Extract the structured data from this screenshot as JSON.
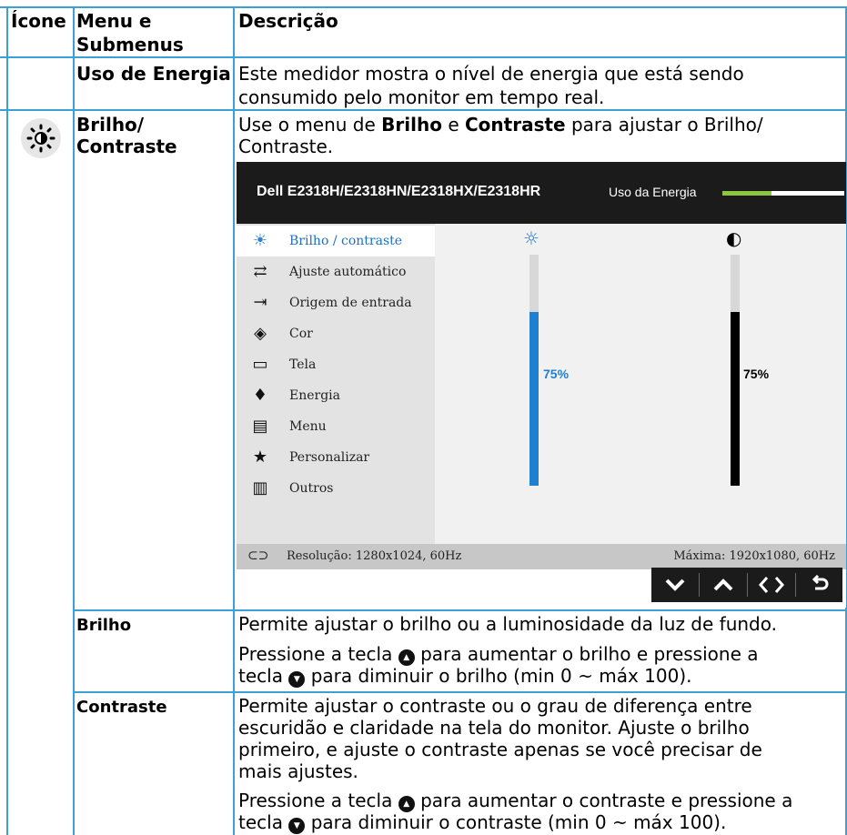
{
  "table": {
    "headers": {
      "icon": "Ícone",
      "menu": "Menu e Submenus",
      "menu_line1": "Menu e",
      "menu_line2": "Submenus",
      "desc": "Descrição"
    },
    "energy_row": {
      "name": "Uso de Energia",
      "desc_line1": "Este medidor mostra o nível de energia que está sendo",
      "desc_line2": "consumido pelo monitor em tempo real."
    },
    "brightness_row": {
      "name_line1": "Brilho/",
      "name_line2": "Contraste",
      "desc_use": "Use o menu de",
      "desc_bold1": "Brilho",
      "desc_e": "e",
      "desc_bold2": "Contraste",
      "desc_rest": "para ajustar o Brilho/",
      "desc_line2": "Contraste."
    },
    "brilho_row": {
      "name": "Brilho",
      "desc_line1": "Permite ajustar o brilho ou a luminosidade da luz de fundo.",
      "press_a": "Pressione a tecla",
      "press_b": "para aumentar o brilho e pressione a",
      "press_c": "tecla",
      "press_d": "para diminuir o brilho (min 0 ~ máx 100)."
    },
    "contraste_row": {
      "name": "Contraste",
      "desc_line1": "Permite ajustar o contraste ou o grau de diferença entre",
      "desc_line2": "escuridão e claridade na tela do monitor. Ajuste o brilho",
      "desc_line3": "primeiro, e ajuste o contraste apenas se você precisar de",
      "desc_line4": "mais ajustes.",
      "press_a": "Pressione a tecla",
      "press_b": "para aumentar o contraste e pressione a",
      "press_c": "tecla",
      "press_d": "para diminuir o contraste (min 0 ~ máx 100)."
    }
  },
  "osd": {
    "model": "Dell E2318H/E2318HN/E2318HX/E2318HR",
    "power_label": "Uso da Energia",
    "power_level": 0.4,
    "menu_items": [
      {
        "label": "Brilho / contraste",
        "icon": "sun-contrast-icon",
        "glyph": "☀"
      },
      {
        "label": "Ajuste automático",
        "icon": "auto-adjust-icon",
        "glyph": "⇄"
      },
      {
        "label": "Origem de entrada",
        "icon": "input-source-icon",
        "glyph": "⇥"
      },
      {
        "label": "Cor",
        "icon": "color-icon",
        "glyph": "◈"
      },
      {
        "label": "Tela",
        "icon": "display-icon",
        "glyph": "▭"
      },
      {
        "label": "Energia",
        "icon": "energy-icon",
        "glyph": "♦"
      },
      {
        "label": "Menu",
        "icon": "menu-icon",
        "glyph": "▤"
      },
      {
        "label": "Personalizar",
        "icon": "star-icon",
        "glyph": "★"
      },
      {
        "label": "Outros",
        "icon": "others-icon",
        "glyph": "▥"
      }
    ],
    "brightness": {
      "value": 75,
      "label": "75%",
      "color": "#1e80cf"
    },
    "contrast": {
      "value": 75,
      "label": "75%",
      "color": "#000000"
    },
    "resolution": "Resolução: 1280x1024, 60Hz",
    "max_resolution": "Máxima: 1920x1080, 60Hz",
    "nav_buttons": [
      "chevron-down-icon",
      "chevron-up-icon",
      "arrows-left-right-icon",
      "back-icon"
    ]
  },
  "colors": {
    "border": "#3aa0d8",
    "accent": "#1e80cf",
    "power_fill": "#8cc63f"
  }
}
